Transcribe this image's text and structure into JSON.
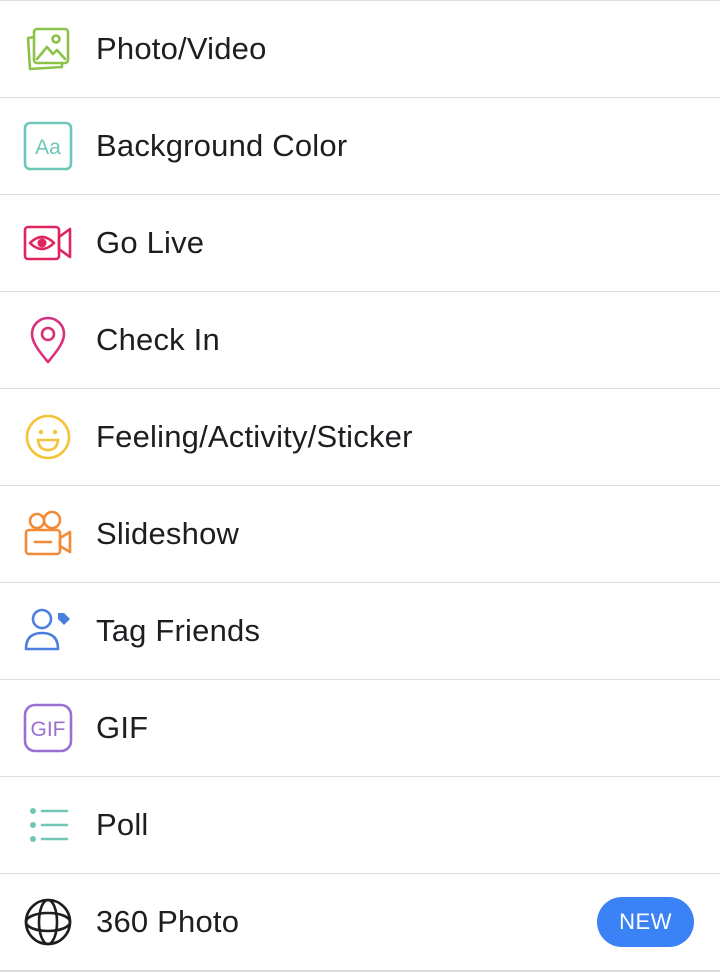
{
  "menu": {
    "items": [
      {
        "label": "Photo/Video",
        "icon": "photo-video-icon",
        "color": "#8bc34a"
      },
      {
        "label": "Background Color",
        "icon": "background-color-icon",
        "icon_text": "Aa",
        "color": "#6cc7b9"
      },
      {
        "label": "Go Live",
        "icon": "live-camera-icon",
        "color": "#e0245e"
      },
      {
        "label": "Check In",
        "icon": "location-pin-icon",
        "color": "#d8307a"
      },
      {
        "label": "Feeling/Activity/Sticker",
        "icon": "smiley-icon",
        "color": "#f5c33b"
      },
      {
        "label": "Slideshow",
        "icon": "movie-camera-icon",
        "color": "#f28b35"
      },
      {
        "label": "Tag Friends",
        "icon": "tag-friends-icon",
        "color": "#4a7fe0"
      },
      {
        "label": "GIF",
        "icon": "gif-icon",
        "icon_text": "GIF",
        "color": "#9b6fd1"
      },
      {
        "label": "Poll",
        "icon": "poll-list-icon",
        "color": "#73c6b6"
      },
      {
        "label": "360 Photo",
        "icon": "photo-360-icon",
        "color": "#1c1e21",
        "badge": "NEW",
        "badge_color": "#3b82f6"
      }
    ]
  }
}
